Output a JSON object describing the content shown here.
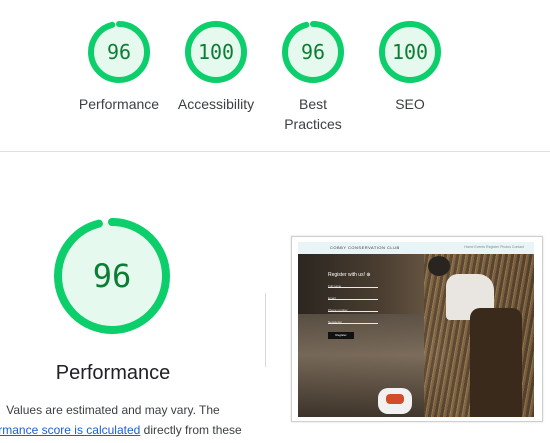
{
  "summary_gauges": [
    {
      "score": "96",
      "label_lines": [
        "Performance"
      ],
      "fraction": 0.96
    },
    {
      "score": "100",
      "label_lines": [
        "Accessibility"
      ],
      "fraction": 1.0
    },
    {
      "score": "96",
      "label_lines": [
        "Best",
        "Practices"
      ],
      "fraction": 0.96
    },
    {
      "score": "100",
      "label_lines": [
        "SEO"
      ],
      "fraction": 1.0
    }
  ],
  "main": {
    "score": "96",
    "fraction": 0.96,
    "title": "Performance",
    "desc_line1": "Values are estimated and may vary. The",
    "desc_link": "rformance score is calculated",
    "desc_after_link": " directly from these"
  },
  "screenshot": {
    "brand": "COBBY CONSERVATION CLUB",
    "nav_links": "Home   Events   Register   Photos   Contact",
    "form_title": "Register with us! ⊕",
    "field_labels": [
      "Full name",
      "Email",
      "Phone number",
      "Newsletter"
    ],
    "button": "Register"
  },
  "colors": {
    "gauge_pass": "#0cce6b",
    "gauge_fill": "#e6f9ee",
    "gauge_text": "#0c7d35",
    "link": "#1a5fd0"
  }
}
